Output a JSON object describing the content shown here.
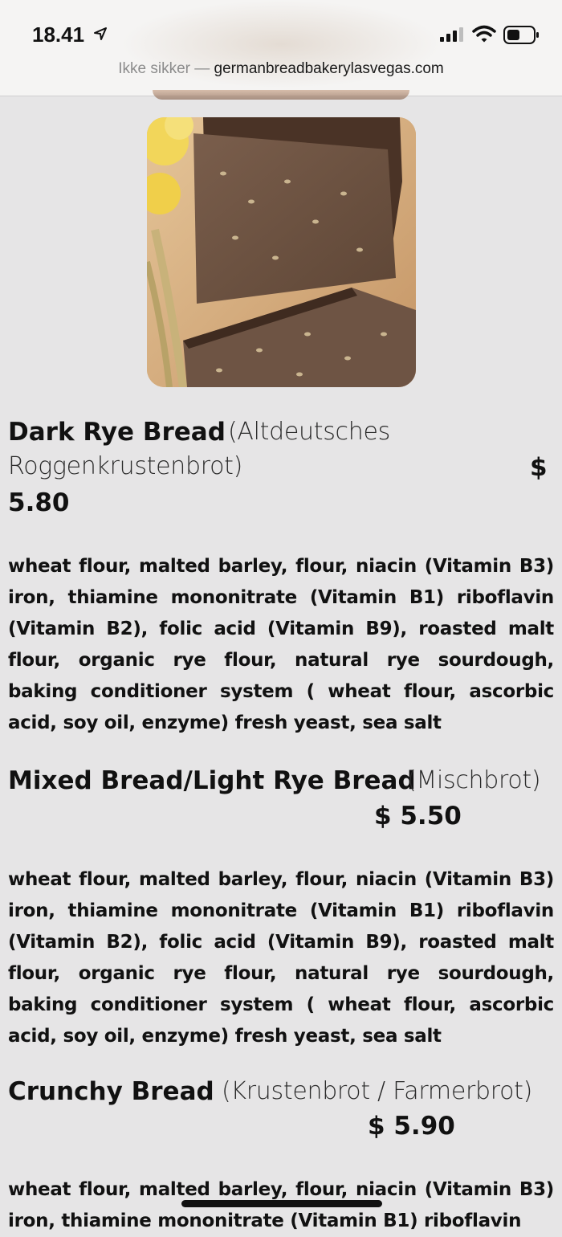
{
  "status_bar": {
    "time": "18.41",
    "location_icon": "location-arrow-icon",
    "signal_icon": "cellular-signal-icon",
    "wifi_icon": "wifi-icon",
    "battery_icon": "battery-icon"
  },
  "address_bar": {
    "security_label": "Ikke sikker",
    "separator": " — ",
    "domain": "germanbreadbakerylasvegas.com"
  },
  "products": [
    {
      "name": "Dark Rye Bread",
      "german_name_line1": "(Altdeutsches",
      "german_name_line2": "Roggenkrustenbrot)",
      "price_symbol": "$",
      "price_value": "5.80",
      "ingredients": "wheat flour, malted barley, flour, niacin (Vitamin B3) iron, thiamine mononitrate (Vitamin B1) riboflavin (Vitamin B2), folic acid (Vitamin B9),  roasted malt flour, organic rye flour, natural rye sourdough, baking conditioner system ( wheat flour, ascorbic acid, soy oil, enzyme) fresh yeast, sea salt"
    },
    {
      "name": "Mixed Bread/Light Rye Bread",
      "german_name": "(Mischbrot)",
      "price": "$ 5.50",
      "ingredients": "wheat flour, malted barley, flour, niacin (Vitamin B3) iron, thiamine mononitrate (Vitamin B1) riboflavin (Vitamin B2), folic acid (Vitamin B9), roasted malt flour, organic rye flour, natural rye sourdough, baking conditioner system ( wheat flour, ascorbic acid, soy oil, enzyme) fresh yeast, sea salt"
    },
    {
      "name": "Crunchy Bread",
      "german_name": "(Krustenbrot / Farmerbrot)",
      "price": "$ 5.90",
      "ingredients": "wheat flour, malted barley, flour, niacin (Vitamin B3) iron, thiamine mononitrate (Vitamin B1) riboflavin"
    }
  ],
  "colors": {
    "page_background": "#e6e5e6",
    "text": "#111111",
    "url_insecure": "#8c8c8c"
  }
}
